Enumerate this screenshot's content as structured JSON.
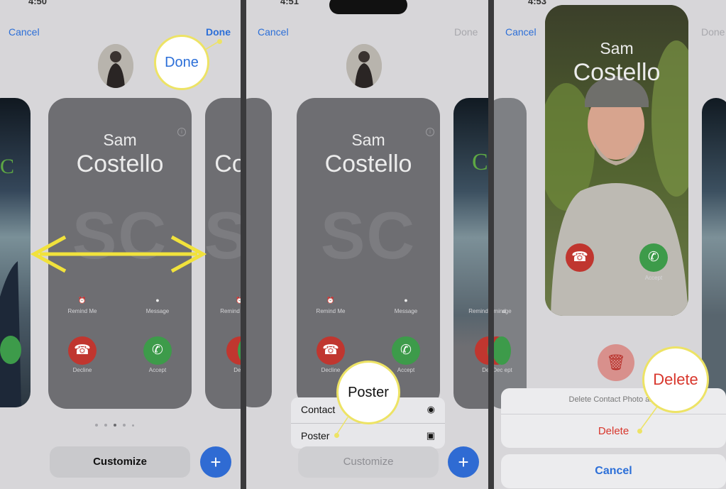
{
  "panel1": {
    "statusbar_time": "4:50",
    "cancel_label": "Cancel",
    "done_label": "Done",
    "callout_label": "Done",
    "card": {
      "first_name": "Sam",
      "last_name": "Costello",
      "monogram": "SC",
      "remind_label": "Remind Me",
      "message_label": "Message",
      "decline_label": "Decline",
      "accept_label": "Accept"
    },
    "side_card_partial": "Co",
    "side_card_remind_partial": "Remind",
    "side_card_message_partial": "age",
    "side_card_decline_accept_partial": "Dec  ept",
    "customize_label": "Customize",
    "plus_label": "+",
    "page_dots": 5,
    "active_dot": 3
  },
  "panel2": {
    "statusbar_time": "4:51",
    "cancel_label": "Cancel",
    "done_label": "Done",
    "card": {
      "first_name": "Sam",
      "last_name": "Costello",
      "monogram": "SC",
      "remind_label": "Remind Me",
      "message_label": "Message",
      "decline_label": "Decline",
      "accept_label": "Accept"
    },
    "side_card_partial": "C",
    "side_card_partial_2": "o",
    "side_card_remind_partial": "Remind",
    "side_card_message_partial": "age",
    "side_card_decline_accept_partial": "Dec  ept",
    "menu": {
      "items": [
        {
          "label": "Contact",
          "icon": "person-circle-icon"
        },
        {
          "label": "Poster",
          "icon": "poster-card-icon"
        }
      ]
    },
    "callout_label": "Poster",
    "customize_label": "Customize",
    "plus_label": "+"
  },
  "panel3": {
    "statusbar_time": "4:53",
    "cancel_label": "Cancel",
    "done_label": "Done",
    "card": {
      "first_name": "Sam",
      "last_name": "Costello",
      "accept_label": "Accept"
    },
    "side_card_remind_partial": "Remind",
    "side_card_message_partial": "age",
    "side_card_decline_accept_partial": "Dec  ept",
    "sheet": {
      "title": "Delete Contact Photo and",
      "delete_label": "Delete"
    },
    "callout_label": "Delete",
    "cancel_button_label": "Cancel"
  },
  "colors": {
    "accent_blue": "#2c6fd8",
    "destructive_red": "#d8362c",
    "callout_yellow": "#ede365",
    "decline_red": "#c0362f",
    "accept_green": "#3d9b4a"
  }
}
